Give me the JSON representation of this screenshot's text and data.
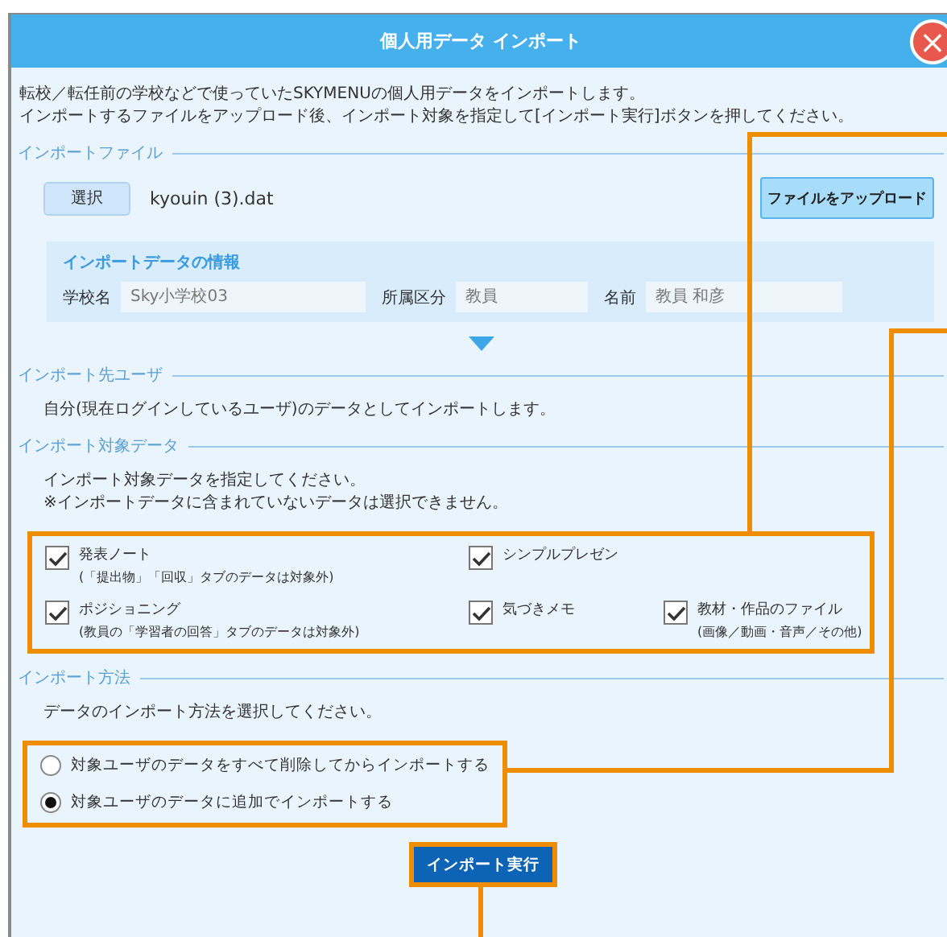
{
  "window": {
    "title": "個人用データ インポート",
    "close_label": "×"
  },
  "intro": [
    "転校／転任前の学校などで使っていたSKYMENUの個人用データをインポートします。",
    "インポートするファイルをアップロード後、インポート対象を指定して[インポート実行]ボタンを押してください。"
  ],
  "import_file": {
    "heading": "インポートファイル",
    "select_button": "選択",
    "file_name": "kyouin (3).dat",
    "upload_button": "ファイルをアップロード"
  },
  "import_info": {
    "heading": "インポートデータの情報",
    "fields": [
      {
        "label": "学校名",
        "value": "Sky小学校03"
      },
      {
        "label": "所属区分",
        "value": "教員"
      },
      {
        "label": "名前",
        "value": "教員 和彦"
      }
    ]
  },
  "target_user": {
    "heading": "インポート先ユーザ",
    "text": "自分(現在ログインしているユーザ)のデータとしてインポートします。"
  },
  "target_data": {
    "heading": "インポート対象データ",
    "text": [
      "インポート対象データを指定してください。",
      "※インポートデータに含まれていないデータは選択できません。"
    ],
    "items": [
      {
        "label": "発表ノート",
        "note": "(「提出物」「回収」タブのデータは対象外)",
        "checked": true
      },
      {
        "label": "シンプルプレゼン",
        "checked": true
      },
      {
        "label": "ポジショニング",
        "note": "(教員の「学習者の回答」タブのデータは対象外)",
        "checked": true
      },
      {
        "label": "気づきメモ",
        "checked": true
      },
      {
        "label": "教材・作品のファイル",
        "note": "(画像／動画・音声／その他)",
        "checked": true
      }
    ]
  },
  "method": {
    "heading": "インポート方法",
    "text": "データのインポート方法を選択してください。",
    "options": [
      {
        "label": "対象ユーザのデータをすべて削除してからインポートする",
        "selected": false
      },
      {
        "label": "対象ユーザのデータに追加でインポートする",
        "selected": true
      }
    ]
  },
  "execute_button": "インポート実行"
}
